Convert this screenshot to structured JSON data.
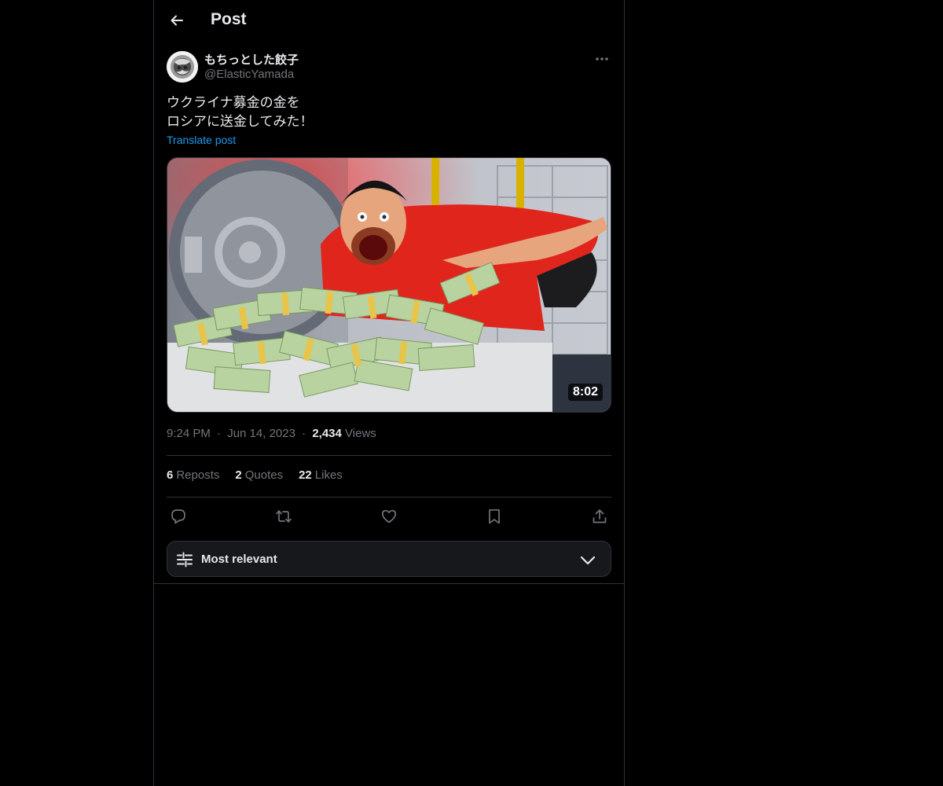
{
  "header": {
    "back_label": "Back",
    "title": "Post"
  },
  "author": {
    "display_name": "もちっとした餃子",
    "handle": "@ElasticYamada"
  },
  "post": {
    "text_line1": "ウクライナ募金の金を",
    "text_line2": "ロシアに送金してみた！",
    "translate_label": "Translate post",
    "video_duration": "8:02"
  },
  "meta": {
    "time": "9:24 PM",
    "separator": "·",
    "date": "Jun 14, 2023",
    "views_count": "2,434",
    "views_label": "Views"
  },
  "stats": {
    "reposts_count": "6",
    "reposts_label": "Reposts",
    "quotes_count": "2",
    "quotes_label": "Quotes",
    "likes_count": "22",
    "likes_label": "Likes"
  },
  "actions": {
    "icons": [
      "reply-icon",
      "repost-icon",
      "like-icon",
      "bookmark-icon",
      "share-icon"
    ]
  },
  "sort": {
    "label": "Most relevant"
  },
  "colors": {
    "background": "#000000",
    "text": "#e7e9ea",
    "muted": "#71767b",
    "accent": "#1d9bf0",
    "border": "#2f3336"
  }
}
